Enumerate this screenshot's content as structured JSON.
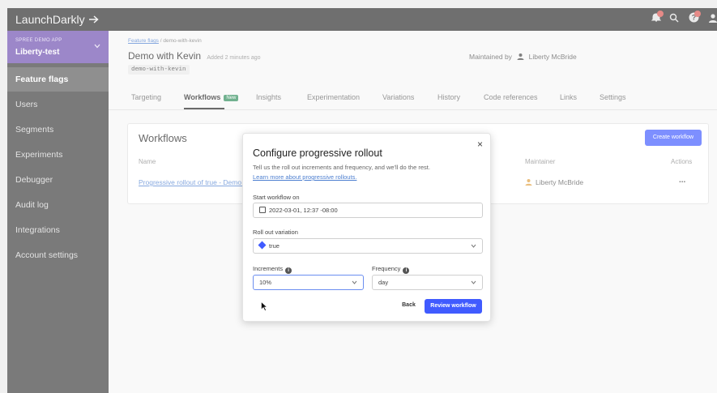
{
  "app": {
    "name": "LaunchDarkly"
  },
  "sidebar": {
    "project_kicker": "SPREE DEMO APP",
    "project_name": "Liberty-test",
    "items": [
      {
        "label": "Feature flags"
      },
      {
        "label": "Users"
      },
      {
        "label": "Segments"
      },
      {
        "label": "Experiments"
      },
      {
        "label": "Debugger"
      },
      {
        "label": "Audit log"
      },
      {
        "label": "Integrations"
      },
      {
        "label": "Account settings"
      }
    ]
  },
  "breadcrumb": {
    "link": "Feature flags",
    "separator": " / ",
    "current": "demo-with-kevin"
  },
  "flag": {
    "title": "Demo with Kevin",
    "added": "Added 2 minutes ago",
    "key": "demo-with-kevin",
    "maintained_by_label": "Maintained by",
    "maintainer": "Liberty McBride"
  },
  "tabs": [
    {
      "label": "Targeting"
    },
    {
      "label": "Workflows",
      "badge": "New"
    },
    {
      "label": "Insights"
    },
    {
      "label": "Experimentation"
    },
    {
      "label": "Variations"
    },
    {
      "label": "History"
    },
    {
      "label": "Code references"
    },
    {
      "label": "Links"
    },
    {
      "label": "Settings"
    }
  ],
  "workflows": {
    "title": "Workflows",
    "create_button": "Create workflow",
    "columns": {
      "name": "Name",
      "maintainer": "Maintainer",
      "actions": "Actions"
    },
    "row": {
      "name": "Progressive rollout of true - Demo with Kevin",
      "maintainer": "Liberty McBride",
      "actions": "..."
    }
  },
  "modal": {
    "title": "Configure progressive rollout",
    "close": "×",
    "description": "Tell us the roll out increments and frequency, and we'll do the rest.",
    "learn_more": "Learn more about progressive rollouts.",
    "start_label": "Start workflow on",
    "start_value": "2022-03-01, 12:37 -08:00",
    "variation_label": "Roll out variation",
    "variation_value": "true",
    "increments_label": "Increments",
    "increments_value": "10%",
    "frequency_label": "Frequency",
    "frequency_value": "day",
    "back_button": "Back",
    "review_button": "Review workflow"
  },
  "colors": {
    "accent": "#405bff",
    "project": "#6e4fb0",
    "sidebar": "#3b3b3b",
    "topbar": "#2b2b2b"
  },
  "icons": [
    "arrow-icon",
    "bell-icon",
    "search-icon",
    "help-icon",
    "user-icon",
    "chevron-down-icon",
    "calendar-icon",
    "flag-icon",
    "info-icon",
    "close-icon",
    "cursor-icon"
  ]
}
